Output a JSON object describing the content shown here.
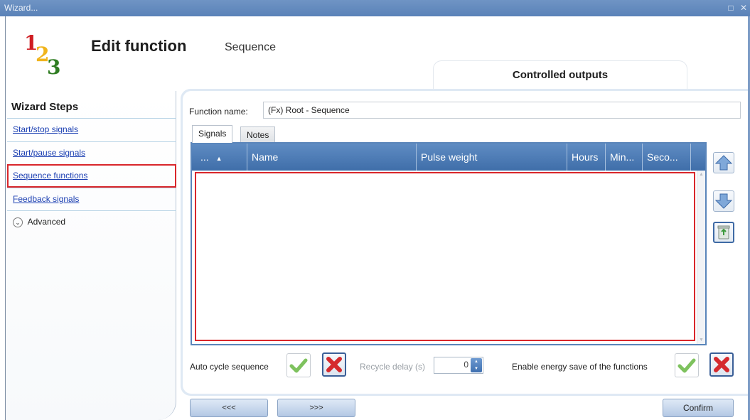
{
  "window": {
    "title": "Wizard...",
    "controls": [
      "□",
      "✕"
    ]
  },
  "header": {
    "logo_digits": [
      "1",
      "2",
      "3"
    ],
    "title": "Edit function",
    "subtitle": "Sequence",
    "section_tab": "Controlled outputs"
  },
  "sidebar": {
    "title": "Wizard Steps",
    "items": [
      {
        "label": "Start/stop signals"
      },
      {
        "label": "Start/pause signals"
      },
      {
        "label": "Sequence functions",
        "selected": true
      },
      {
        "label": "Feedback signals"
      }
    ],
    "advanced_label": "Advanced"
  },
  "form": {
    "function_name_label": "Function name:",
    "function_name_value": "(Fx) Root - Sequence",
    "tabs": [
      {
        "label": "Signals",
        "active": true
      },
      {
        "label": "Notes",
        "active": false
      }
    ]
  },
  "grid": {
    "columns": [
      {
        "label": "..."
      },
      {
        "label": "Name"
      },
      {
        "label": "Pulse weight"
      },
      {
        "label": "Hours"
      },
      {
        "label": "Min..."
      },
      {
        "label": "Seco..."
      }
    ],
    "rows": []
  },
  "options": {
    "auto_cycle_label": "Auto cycle sequence",
    "recycle_delay_label": "Recycle delay (s)",
    "recycle_delay_value": "0",
    "energy_save_label": "Enable energy save of the functions"
  },
  "footer": {
    "prev_label": "<<<",
    "next_label": ">>>",
    "confirm_label": "Confirm"
  },
  "colors": {
    "titlebar": "#6f94c4",
    "grid_header": "#4d7bb6",
    "highlight_red": "#d9262b",
    "check_green": "#5fae3b",
    "cancel_red": "#d52a2e"
  }
}
